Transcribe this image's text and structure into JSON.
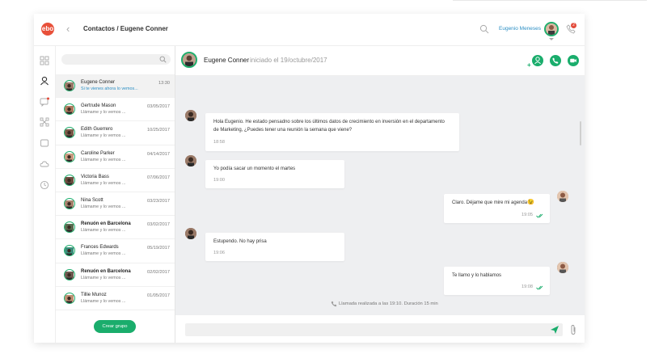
{
  "header": {
    "logo_text": "ebo",
    "breadcrumb": "Contactos / Eugene Conner",
    "user_name": "Eugenio Meneses",
    "phone_badge": "2",
    "accent": "#1aad6c",
    "link_color": "#2c8fc4"
  },
  "rail": {
    "icons": [
      "grid-icon",
      "contacts-icon",
      "chat-icon",
      "network-icon",
      "tablet-icon",
      "cloud-icon",
      "clock-icon"
    ]
  },
  "contacts": {
    "items": [
      {
        "name": "Eugene Conner",
        "preview": "Si te vienes ahora lo vemos...",
        "date": "13:30",
        "bold": false,
        "active": true,
        "preview_blue": true
      },
      {
        "name": "Gertrude Mason",
        "preview": "Llámame y lo vemos ...",
        "date": "03/05/2017",
        "bold": false,
        "active": false,
        "preview_blue": false
      },
      {
        "name": "Edith Guerrero",
        "preview": "Llámame y lo vemos ...",
        "date": "10/25/2017",
        "bold": false,
        "active": false,
        "preview_blue": false
      },
      {
        "name": "Caroline Parker",
        "preview": "Llámame y lo vemos ...",
        "date": "04/14/2017",
        "bold": false,
        "active": false,
        "preview_blue": false
      },
      {
        "name": "Victoria Bass",
        "preview": "Llámame y lo vemos ...",
        "date": "07/06/2017",
        "bold": false,
        "active": false,
        "preview_blue": false
      },
      {
        "name": "Nina Scott",
        "preview": "Llámame y lo vemos ...",
        "date": "03/23/2017",
        "bold": false,
        "active": false,
        "preview_blue": false
      },
      {
        "name": "Renuón en Barcelona",
        "preview": "Llámame y lo vemos ...",
        "date": "03/02/2017",
        "bold": true,
        "active": false,
        "preview_blue": false
      },
      {
        "name": "Frances Edwards",
        "preview": "Llámame y lo vemos ...",
        "date": "05/19/2017",
        "bold": false,
        "active": false,
        "preview_blue": false
      },
      {
        "name": "Renuón en Barcelona",
        "preview": "Llámame y lo vemos ...",
        "date": "02/02/2017",
        "bold": true,
        "active": false,
        "preview_blue": false
      },
      {
        "name": "Tillie Munoz",
        "preview": "Llámame y lo vemos ...",
        "date": "01/05/2017",
        "bold": false,
        "active": false,
        "preview_blue": false
      }
    ],
    "create_group": "Crear grupo"
  },
  "chat": {
    "contact_name": "Eugene Conner",
    "started": "iniciado el 19/octubre/2017",
    "messages": {
      "m1_line1": "Hola Eugenio. He estado pensadno sobre los últimos datos de crecimiento en inversión en el departamento",
      "m1_line2": "de Marketing, ¿Puedes tener una reunión la semana que viene?",
      "m1_time": "18:58",
      "m2_text": "Yo podía sacar un momento el martes",
      "m2_time": "19:00",
      "m3_text": "Claro. Déjame que mire mi agenda",
      "m3_emoji": "😉",
      "m3_time": "19:05",
      "m4_text": "Estupendo. No hay prisa",
      "m4_time": "19:06",
      "m5_text": "Te llamo y lo hablamos",
      "m5_time": "19:08"
    },
    "call_note": "Llamada realizada a las 19:10. Duración 15 min"
  }
}
